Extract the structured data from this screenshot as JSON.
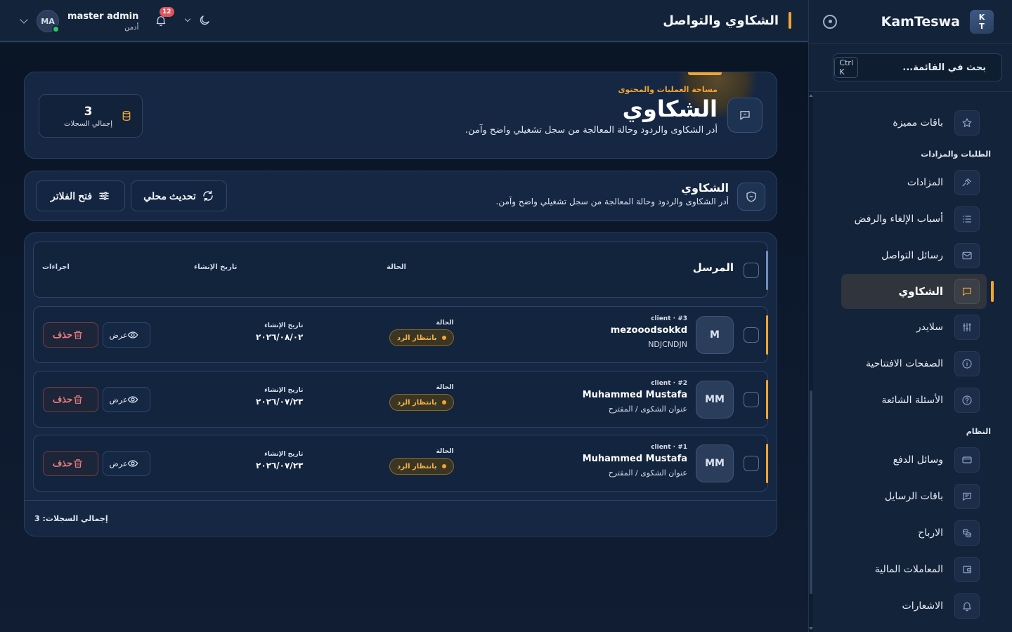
{
  "sidebar": {
    "brand_logo_top": "K",
    "brand_logo_bottom": "T",
    "brand_name": "KamTeswa",
    "search_placeholder": "بحث في القائمة...",
    "search_shortcut": "Ctrl K",
    "items_top": [
      {
        "label": "باقات مميزة",
        "icon": "star-icon"
      }
    ],
    "section_requests": "الطلبات والمزادات",
    "items_requests": [
      {
        "label": "المزادات",
        "icon": "gavel-icon"
      },
      {
        "label": "أسباب الإلغاء والرفض",
        "icon": "list-icon"
      },
      {
        "label": "رسائل التواصل",
        "icon": "mail-icon"
      },
      {
        "label": "الشكاوي",
        "icon": "chat-icon",
        "active": true
      },
      {
        "label": "سلايدر",
        "icon": "sliders-icon"
      },
      {
        "label": "الصفحات الافتتاحية",
        "icon": "info-icon"
      },
      {
        "label": "الأسئلة الشائعة",
        "icon": "question-icon"
      }
    ],
    "section_system": "النظام",
    "items_system": [
      {
        "label": "وسائل الدفع",
        "icon": "card-icon"
      },
      {
        "label": "باقات الرسايل",
        "icon": "message-icon"
      },
      {
        "label": "الارباح",
        "icon": "coins-icon"
      },
      {
        "label": "المعاملات المالية",
        "icon": "wallet-icon"
      },
      {
        "label": "الاشعارات",
        "icon": "bell-icon"
      }
    ]
  },
  "topbar": {
    "page_title": "الشكاوي والتواصل",
    "user_initials": "MA",
    "user_name": "master admin",
    "user_role": "أدمن",
    "notification_count": "12"
  },
  "hero": {
    "eyebrow": "مساحة العمليات والمحتوى",
    "title": "الشكاوي",
    "description": "أدر الشكاوى والردود وحالة المعالجة من سجل تشغيلي واضح وآمن.",
    "stat_value": "3",
    "stat_label": "إجمالي السجلات"
  },
  "toolbar": {
    "title": "الشكاوي",
    "description": "أدر الشكاوى والردود وحالة المعالجة من سجل تشغيلي واضح وآمن.",
    "refresh_label": "تحديث محلي",
    "filter_label": "فتح الفلاتر"
  },
  "table": {
    "headers": {
      "sender": "المرسل",
      "status": "الحالة",
      "created": "تاريخ الإنشاء",
      "actions": "اجراءات"
    },
    "rows": [
      {
        "avatar": "M",
        "tag": "client · #3",
        "name": "mezooodsokkd",
        "subtitle": "NDJCNDJN",
        "status_label": "الحالة",
        "status": "بانتظار الرد",
        "date_label": "تاريخ الإنشاء",
        "date": "٢٠٢٦/٠٨/٠٢",
        "view_label": "عرض",
        "delete_label": "حذف"
      },
      {
        "avatar": "MM",
        "tag": "client · #2",
        "name": "Muhammed Mustafa",
        "subtitle": "عنوان الشكوى / المقترح",
        "status_label": "الحالة",
        "status": "بانتظار الرد",
        "date_label": "تاريخ الإنشاء",
        "date": "٢٠٢٦/٠٧/٢٣",
        "view_label": "عرض",
        "delete_label": "حذف"
      },
      {
        "avatar": "MM",
        "tag": "client · #1",
        "name": "Muhammed Mustafa",
        "subtitle": "عنوان الشكوى / المقترح",
        "status_label": "الحالة",
        "status": "بانتظار الرد",
        "date_label": "تاريخ الإنشاء",
        "date": "٢٠٢٦/٠٧/٢٣",
        "view_label": "عرض",
        "delete_label": "حذف"
      }
    ],
    "footer": "إجمالي السجلات: 3"
  },
  "colors": {
    "accent": "#f2a531",
    "danger": "#f07b84",
    "background": "#0e1a2e",
    "card": "#152743"
  }
}
